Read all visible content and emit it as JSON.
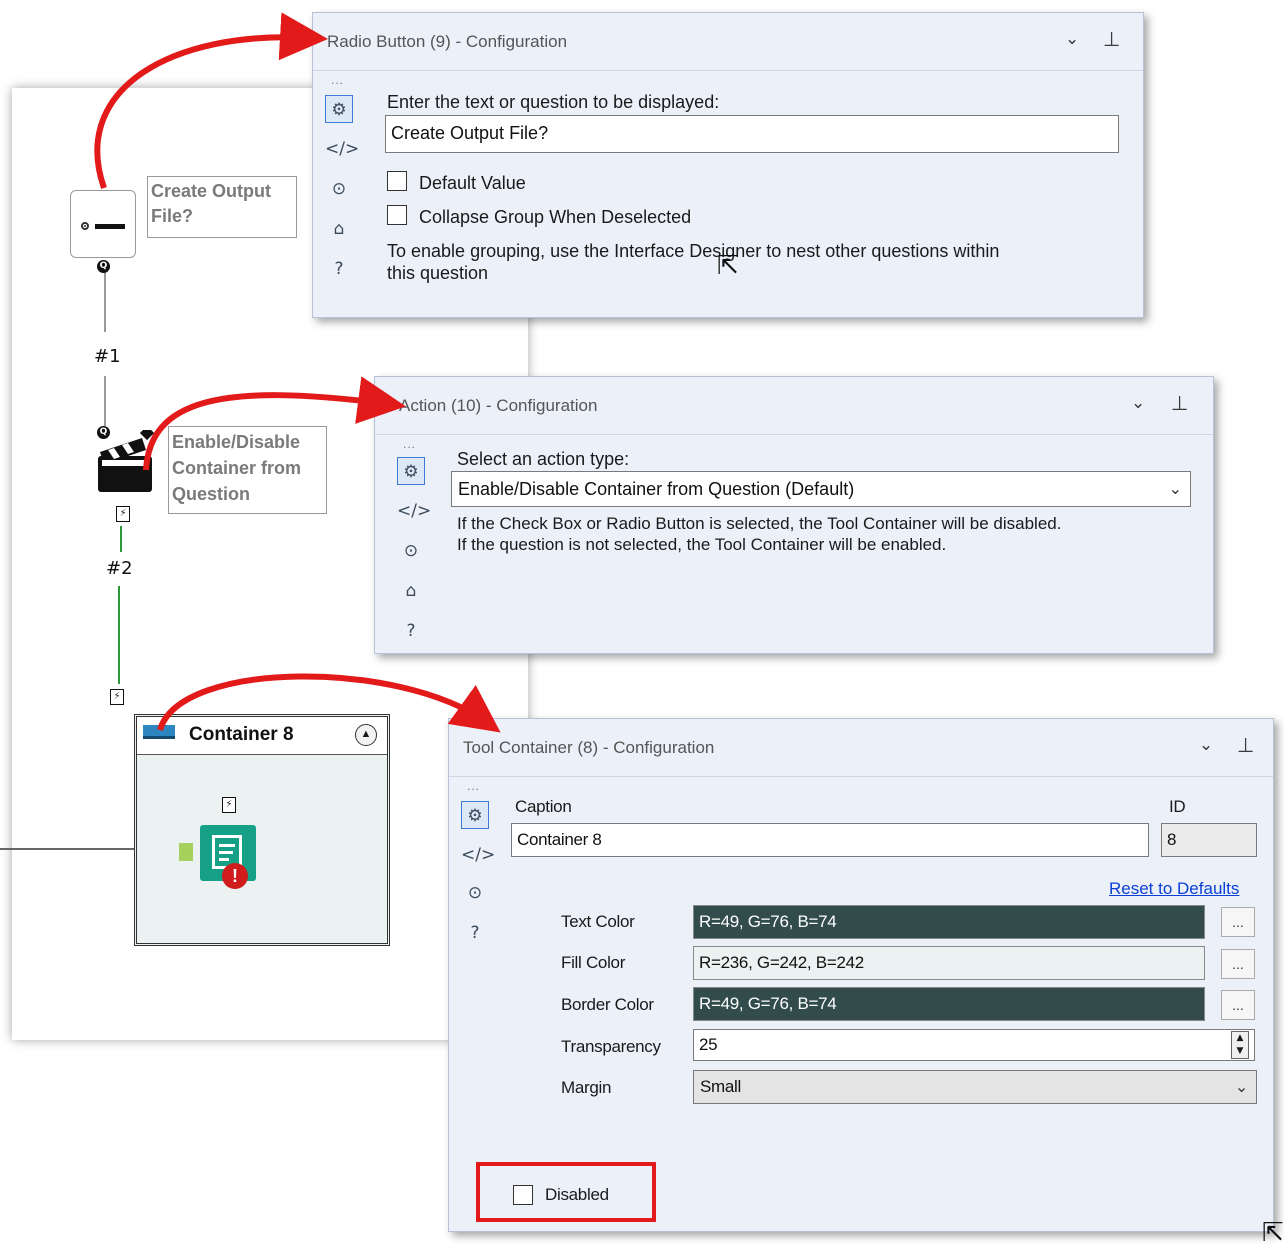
{
  "workflow": {
    "radio_annotation": "Create Output\nFile?",
    "action_annotation": "Enable/Disable\nContainer from\nQuestion",
    "connection_1": "#1",
    "connection_2": "#2",
    "question_badge": "Q",
    "bolt_badge": "⚡",
    "container": {
      "title": "Container 8",
      "collapse_icon": "chevron-up-icon",
      "tool_error_badge": "!"
    }
  },
  "radio_panel": {
    "title": "Radio Button (9) - Configuration",
    "prompt_label": "Enter the text or question to be displayed:",
    "prompt_value": "Create Output File?",
    "default_value_label": "Default Value",
    "default_value_checked": false,
    "collapse_label": "Collapse Group When Deselected",
    "collapse_checked": false,
    "hint_line1": "To enable grouping, use the Interface Designer to nest other questions within",
    "hint_line2": "this question"
  },
  "action_panel": {
    "title": "Action (10) - Configuration",
    "select_label": "Select an action type:",
    "selected_action": "Enable/Disable Container from Question (Default)",
    "desc_line1": "If the Check Box or Radio Button is selected, the Tool Container will be disabled.",
    "desc_line2": "If the question is not selected, the Tool Container will be enabled."
  },
  "container_panel": {
    "title": "Tool Container (8) - Configuration",
    "caption_label": "Caption",
    "caption_value": "Container 8",
    "id_label": "ID",
    "id_value": "8",
    "reset_link": "Reset to Defaults",
    "text_color_label": "Text Color",
    "text_color_value": "R=49, G=76, B=74",
    "fill_color_label": "Fill Color",
    "fill_color_value": "R=236, G=242, B=242",
    "border_color_label": "Border Color",
    "border_color_value": "R=49, G=76, B=74",
    "transparency_label": "Transparency",
    "transparency_value": "25",
    "margin_label": "Margin",
    "margin_value": "Small",
    "disabled_label": "Disabled",
    "disabled_checked": false,
    "ellipsis": "..."
  },
  "common": {
    "rail_dots": "...",
    "chevron_icon": "⌄",
    "pin_icon": "⊥"
  },
  "colors": {
    "text_color_swatch": "#314c4a",
    "fill_color_swatch": "#ecf2f2",
    "border_color_swatch": "#314c4a",
    "arrow_red": "#e21a1a",
    "highlight_red": "#e21a1a"
  }
}
